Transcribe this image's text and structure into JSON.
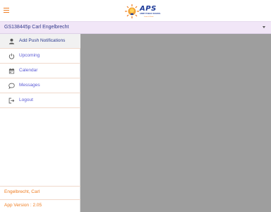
{
  "header": {
    "menu_icon": "hamburger-icon",
    "logo": {
      "text": "APS",
      "subtitle": "ARMY PUBLIC SCHOOL",
      "tagline": "Learn & Grow"
    }
  },
  "student_selector": {
    "label": "GS138445p Carl Engelbrecht",
    "dropdown_icon": "caret-down-icon"
  },
  "drawer": {
    "items": [
      {
        "label": "Add Push Notifications",
        "icon": "person-icon"
      },
      {
        "label": "Upcoming",
        "icon": "power-icon"
      },
      {
        "label": "Calendar",
        "icon": "calendar-icon"
      },
      {
        "label": "Messages",
        "icon": "chat-bubble-icon"
      },
      {
        "label": "Logout",
        "icon": "logout-icon"
      }
    ],
    "footer": {
      "user_name": "Engelbrecht, Carl",
      "app_version": "App Version : 2.05"
    }
  },
  "colors": {
    "accent": "#ef7d22",
    "brand_blue": "#2b3a8f",
    "student_bar_bg": "#f1e6f7",
    "overlay": "#9e9e9e"
  }
}
